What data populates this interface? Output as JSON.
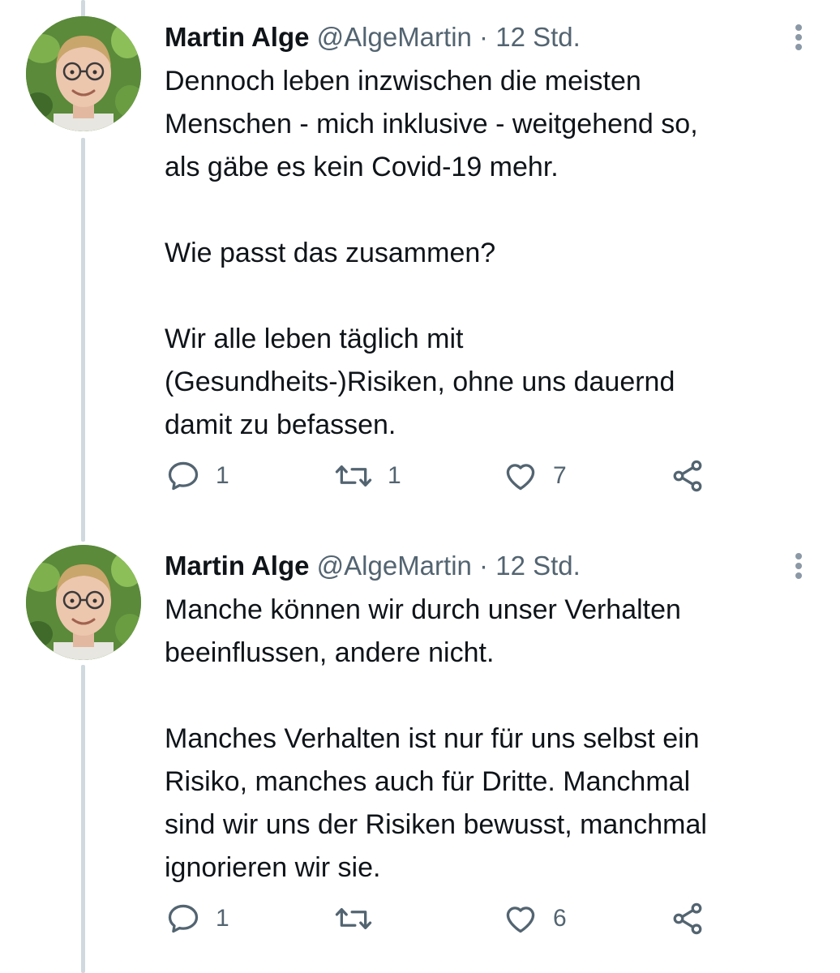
{
  "tweets": [
    {
      "author": {
        "name": "Martin Alge",
        "handle": "@AlgeMartin",
        "avatar_icon": "profile-photo"
      },
      "separator": "·",
      "time": "12 Std.",
      "paragraphs": [
        "Dennoch leben inzwischen die meisten\nMenschen - mich inklusive - weitgehend so,\nals gäbe es kein Covid-19 mehr.",
        "Wie passt das zusammen?",
        "Wir alle leben täglich mit\n(Gesundheits-)Risiken, ohne uns dauernd\ndamit zu befassen."
      ],
      "actions": {
        "reply_count": "1",
        "retweet_count": "1",
        "like_count": "7"
      }
    },
    {
      "author": {
        "name": "Martin Alge",
        "handle": "@AlgeMartin",
        "avatar_icon": "profile-photo"
      },
      "separator": "·",
      "time": "12 Std.",
      "paragraphs": [
        "Manche können wir durch unser Verhalten\nbeeinflussen, andere nicht.",
        "Manches Verhalten ist nur für uns selbst ein\nRisiko, manches auch für Dritte. Manchmal\nsind wir uns der Risiken bewusst, manchmal\nignorieren wir sie."
      ],
      "actions": {
        "reply_count": "1",
        "retweet_count": "",
        "like_count": "6"
      }
    }
  ],
  "colors": {
    "text": "#0f1419",
    "secondary": "#536471",
    "thread_line": "#cfd9de",
    "background": "#ffffff"
  },
  "icons": [
    "reply-icon",
    "retweet-icon",
    "like-icon",
    "share-icon",
    "more-options-icon"
  ]
}
